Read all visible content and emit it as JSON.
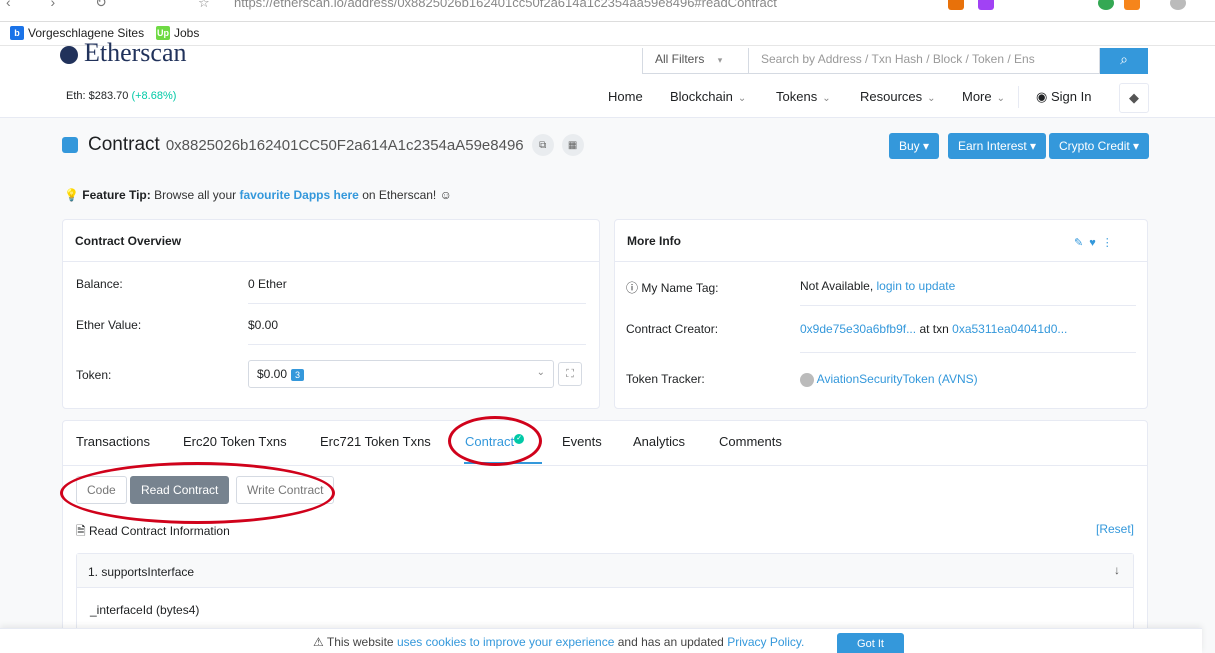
{
  "browser": {
    "url": "https://etherscan.io/address/0x8825026b162401cc50f2a614a1c2354aa59e8496#readContract",
    "bookmarks": [
      {
        "label": "Vorgeschlagene Sites",
        "icon": "bookmark-icon",
        "color": "#1a73e8"
      },
      {
        "label": "Jobs",
        "icon": "upwork-icon",
        "color": "#6fda44"
      }
    ]
  },
  "header": {
    "logo": "Etherscan",
    "eth_price": "Eth: $283.70",
    "eth_change": "(+8.68%)",
    "filter_label": "All Filters",
    "search_placeholder": "Search by Address / Txn Hash / Block / Token / Ens",
    "nav": [
      "Home",
      "Blockchain",
      "Tokens",
      "Resources",
      "More",
      "Sign In"
    ]
  },
  "contract": {
    "label": "Contract",
    "address": "0x8825026b162401CC50F2a614A1c2354aA59e8496",
    "buttons": [
      "Buy",
      "Earn Interest",
      "Crypto Credit"
    ]
  },
  "tip": {
    "prefix": "Feature Tip:",
    "text": "Browse all your",
    "link": "favourite Dapps here",
    "suffix": "on Etherscan! ☺"
  },
  "overview": {
    "title": "Contract Overview",
    "balance_label": "Balance:",
    "balance": "0 Ether",
    "ether_value_label": "Ether Value:",
    "ether_value": "$0.00",
    "token_label": "Token:",
    "token_value": "$0.00",
    "token_count": "3"
  },
  "more_info": {
    "title": "More Info",
    "name_tag_label": "My Name Tag:",
    "name_tag_value": "Not Available,",
    "name_tag_link": "login to update",
    "creator_label": "Contract Creator:",
    "creator_addr": "0x9de75e30a6bfb9f...",
    "creator_mid": "at txn",
    "creator_txn": "0xa5311ea04041d0...",
    "tracker_label": "Token Tracker:",
    "tracker_value": "AviationSecurityToken (AVNS)"
  },
  "tabs": [
    "Transactions",
    "Erc20 Token Txns",
    "Erc721 Token Txns",
    "Contract",
    "Events",
    "Analytics",
    "Comments"
  ],
  "subtabs": [
    "Code",
    "Read Contract",
    "Write Contract"
  ],
  "read": {
    "title": "Read Contract Information",
    "reset": "[Reset]",
    "fn1": "1. supportsInterface",
    "param1": "_interfaceId (bytes4)"
  },
  "cookie": {
    "pre": "This website",
    "link1": "uses cookies to improve your experience",
    "mid": "and has an updated",
    "link2": "Privacy Policy.",
    "button": "Got It"
  }
}
